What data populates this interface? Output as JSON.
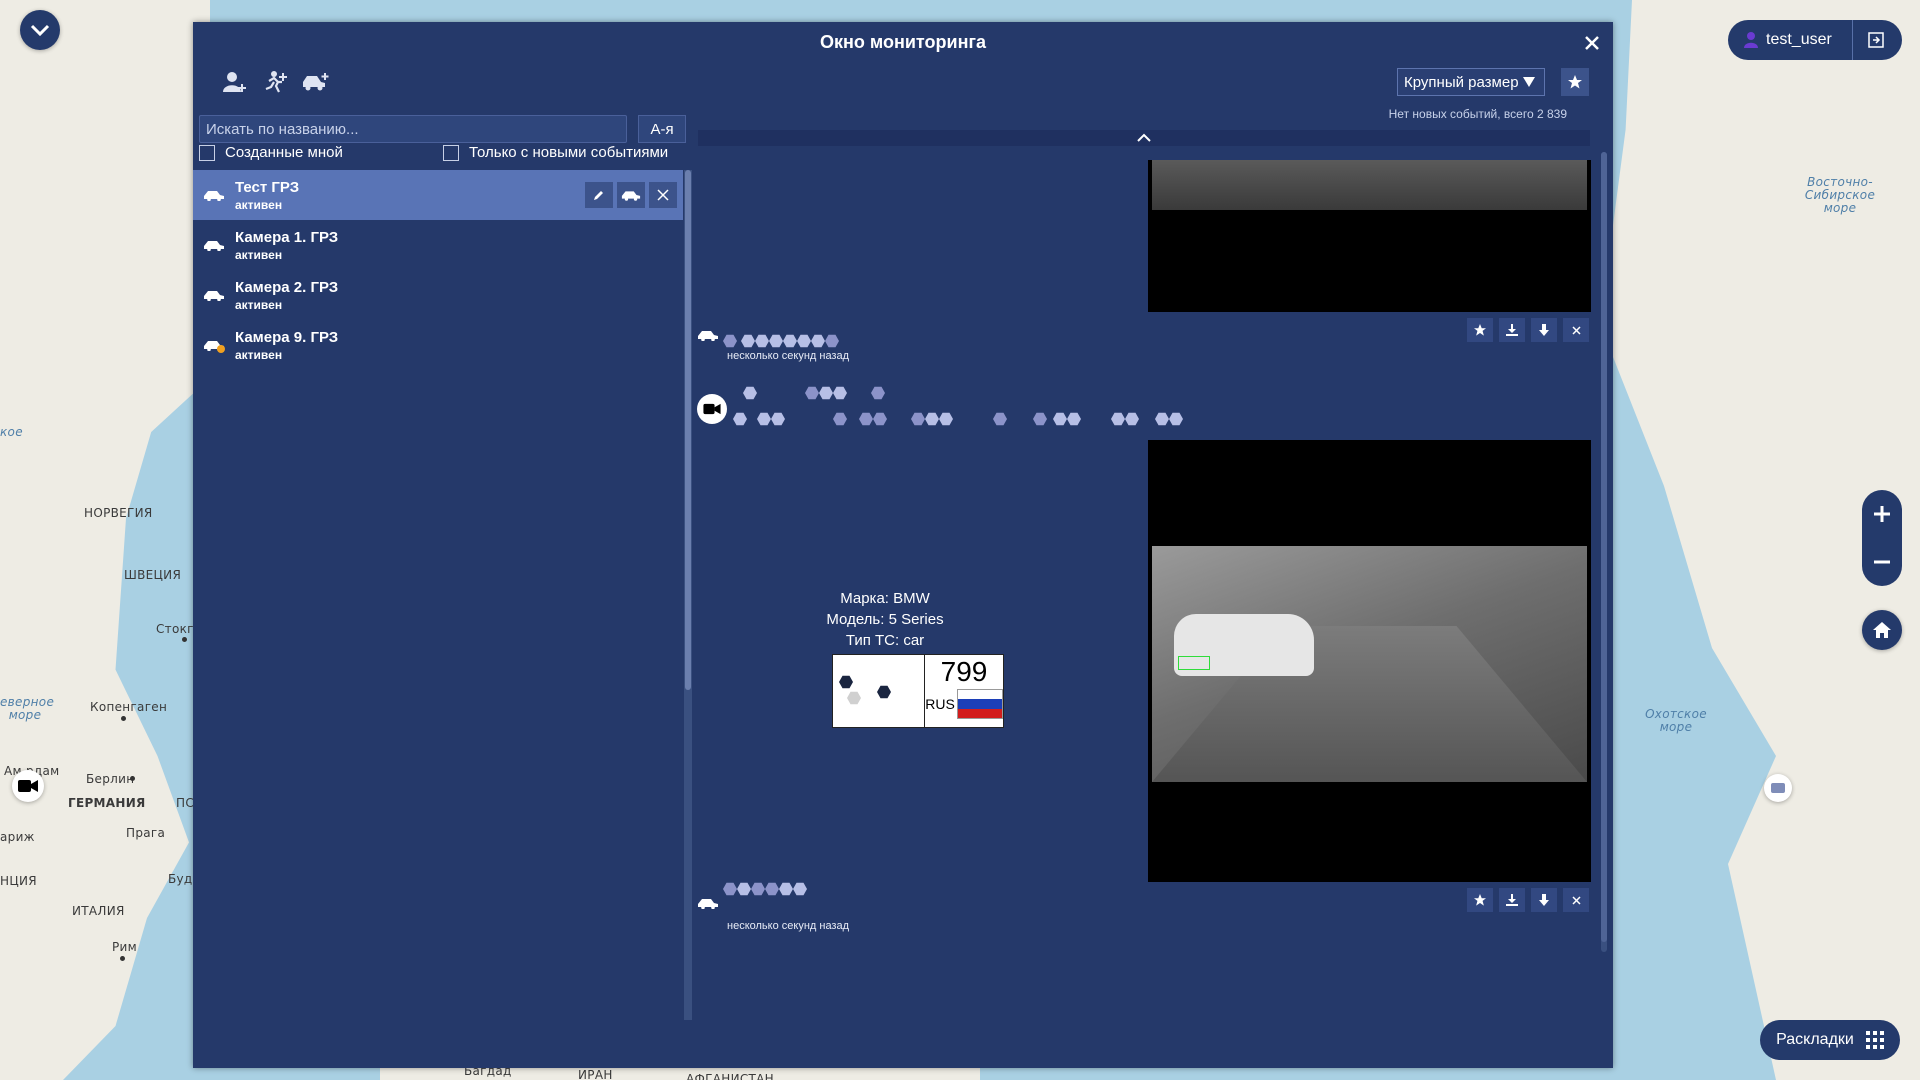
{
  "window": {
    "title": "Окно мониторинга",
    "search_placeholder": "Искать по названию...",
    "sort_label": "А-я",
    "filter_created_by_me": "Созданные мной",
    "filter_new_events": "Только с новыми событиями",
    "size_select": "Крупный размер",
    "events_status": "Нет новых событий, всего 2 839"
  },
  "cameras": [
    {
      "name": "Тест ГРЗ",
      "status": "активен"
    },
    {
      "name": "Камера 1. ГРЗ",
      "status": "активен"
    },
    {
      "name": "Камера 2. ГРЗ",
      "status": "активен"
    },
    {
      "name": "Камера 9. ГРЗ",
      "status": "активен"
    }
  ],
  "events": [
    {
      "time": "несколько секунд назад"
    },
    {
      "time": "несколько секунд назад"
    }
  ],
  "vehicle": {
    "make": "Марка: BMW",
    "model": "Модель: 5 Series",
    "type": "Тип ТС: car",
    "plate_number": "799",
    "plate_country": "RUS"
  },
  "user": {
    "name": "test_user"
  },
  "layouts_label": "Раскладки",
  "map_labels": {
    "norway": "НОРВЕГИЯ",
    "sweden": "ШВЕЦИЯ",
    "stockholm": "Стокго",
    "copenhagen": "Копенгаген",
    "berlin": "Берлин",
    "germany": "ГЕРМАНИЯ",
    "prague": "Прага",
    "italy": "ИТАЛИЯ",
    "rome": "Рим",
    "paris": "ариж",
    "france": "НЦИЯ",
    "amsterdam": "Ам  рдам",
    "po": "ПС",
    "buda": "Буд",
    "north_sea": "еверное море",
    "koe": "кое",
    "east_siberian_sea": "Восточно-Сибирское море",
    "okhotsk_sea": "Охотское море",
    "baghdad": "Багдад",
    "iran": "ИРАН",
    "afghanistan": "АФГАНИСТАН"
  },
  "icons": [
    "chevron-down-icon",
    "person-add-icon",
    "runner-add-icon",
    "car-add-icon",
    "close-icon",
    "star-icon",
    "download-icon",
    "save-icon",
    "car-icon",
    "camera-icon",
    "edit-icon",
    "user-icon",
    "logout-icon",
    "plus-icon",
    "minus-icon",
    "home-icon",
    "grid-icon"
  ],
  "colors": {
    "window_bg": "#25396a",
    "selected_row": "#5974b6",
    "accent": "#243a6b",
    "map_water": "#a9d0e3",
    "map_land": "#eeece4"
  }
}
